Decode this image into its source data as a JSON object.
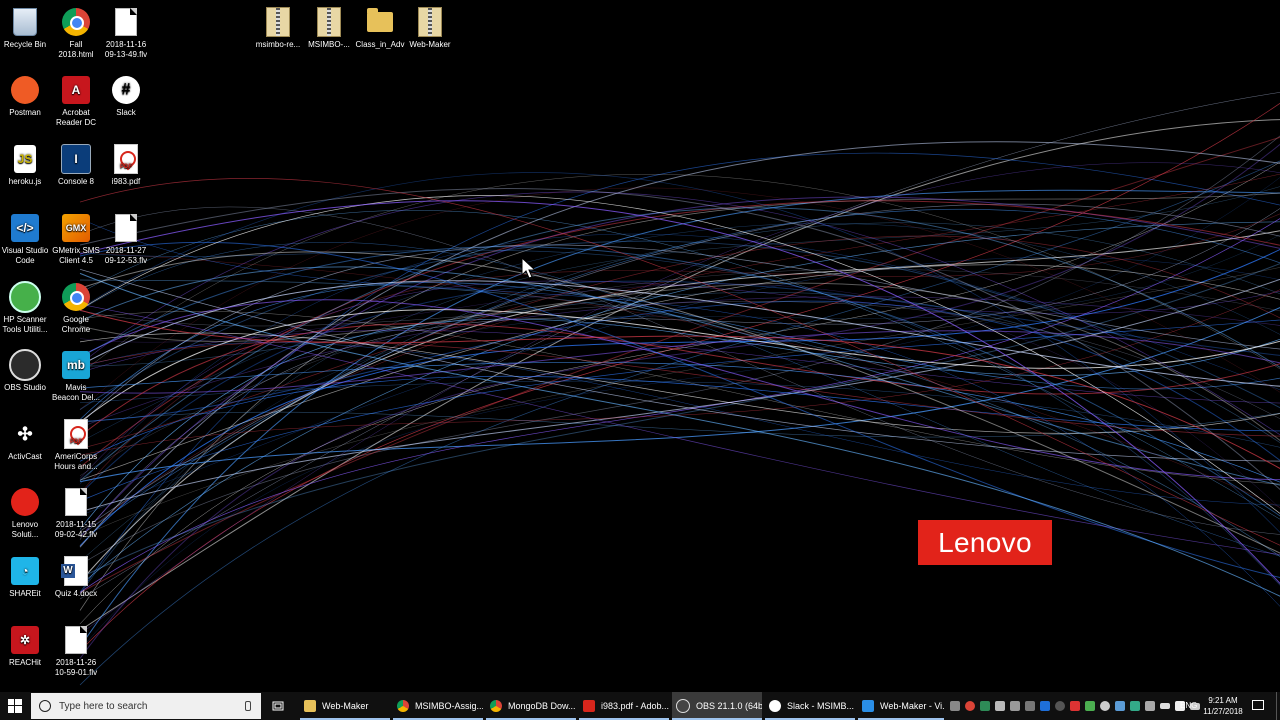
{
  "desktop": {
    "brand_logo": "Lenovo",
    "icons": [
      {
        "label": "Recycle Bin",
        "icon": "recycle-bin-icon"
      },
      {
        "label": "Fall\n2018.html",
        "icon": "chrome-icon"
      },
      {
        "label": "2018-11-16\n09-13-49.flv",
        "icon": "document-icon"
      },
      {
        "label": "msimbo-re...",
        "icon": "zip-folder-icon"
      },
      {
        "label": "MSIMBO-...",
        "icon": "zip-folder-icon"
      },
      {
        "label": "Class_in_Adv",
        "icon": "folder-icon"
      },
      {
        "label": "Web-Maker",
        "icon": "zip-folder-icon"
      },
      {
        "label": "Postman",
        "icon": "postman-icon"
      },
      {
        "label": "Acrobat\nReader DC",
        "icon": "acrobat-icon"
      },
      {
        "label": "Slack",
        "icon": "slack-icon"
      },
      {
        "label": "heroku.js",
        "icon": "js-file-icon"
      },
      {
        "label": "Console 8",
        "icon": "console-icon"
      },
      {
        "label": "i983.pdf",
        "icon": "pdf-icon"
      },
      {
        "label": "Visual Studio\nCode",
        "icon": "vscode-icon"
      },
      {
        "label": "GMetrix SMS\nClient 4.5",
        "icon": "gmetrix-icon"
      },
      {
        "label": "2018-11-27\n09-12-53.flv",
        "icon": "document-icon"
      },
      {
        "label": "HP Scanner\nTools Utiliti...",
        "icon": "hp-scanner-icon"
      },
      {
        "label": "Google\nChrome",
        "icon": "chrome-icon"
      },
      {
        "label": "OBS Studio",
        "icon": "obs-icon"
      },
      {
        "label": "Mavis\nBeacon Del...",
        "icon": "mavis-beacon-icon"
      },
      {
        "label": "ActivCast",
        "icon": "activcast-icon"
      },
      {
        "label": "AmeriCorps\nHours and...",
        "icon": "pdf-icon"
      },
      {
        "label": "Lenovo\nSoluti...",
        "icon": "lenovo-solution-icon"
      },
      {
        "label": "2018-11-15\n09-02-42.flv",
        "icon": "document-icon"
      },
      {
        "label": "SHAREit",
        "icon": "shareit-icon"
      },
      {
        "label": "Quiz 4.docx",
        "icon": "word-document-icon"
      },
      {
        "label": "REACHit",
        "icon": "reachit-icon"
      },
      {
        "label": "2018-11-26\n10-59-01.flv",
        "icon": "document-icon"
      }
    ]
  },
  "taskbar": {
    "search_placeholder": "Type here to search",
    "apps": [
      {
        "label": "Web-Maker",
        "icon": "folder-icon",
        "color": "#e7c15a"
      },
      {
        "label": "MSIMBO-Assig...",
        "icon": "chrome-icon",
        "color": "#db4437"
      },
      {
        "label": "MongoDB Dow...",
        "icon": "chrome-icon",
        "color": "#db4437"
      },
      {
        "label": "i983.pdf - Adob...",
        "icon": "acrobat-icon",
        "color": "#d7261c"
      },
      {
        "label": "OBS 21.1.0 (64bi...",
        "icon": "obs-icon",
        "color": "#444444"
      },
      {
        "label": "Slack - MSIMB...",
        "icon": "slack-icon",
        "color": "#ffffff"
      },
      {
        "label": "Web-Maker - Vi...",
        "icon": "vscode-icon",
        "color": "#2a8ee6"
      }
    ],
    "language": "ENG",
    "time": "9:21 AM",
    "date": "11/27/2018"
  }
}
